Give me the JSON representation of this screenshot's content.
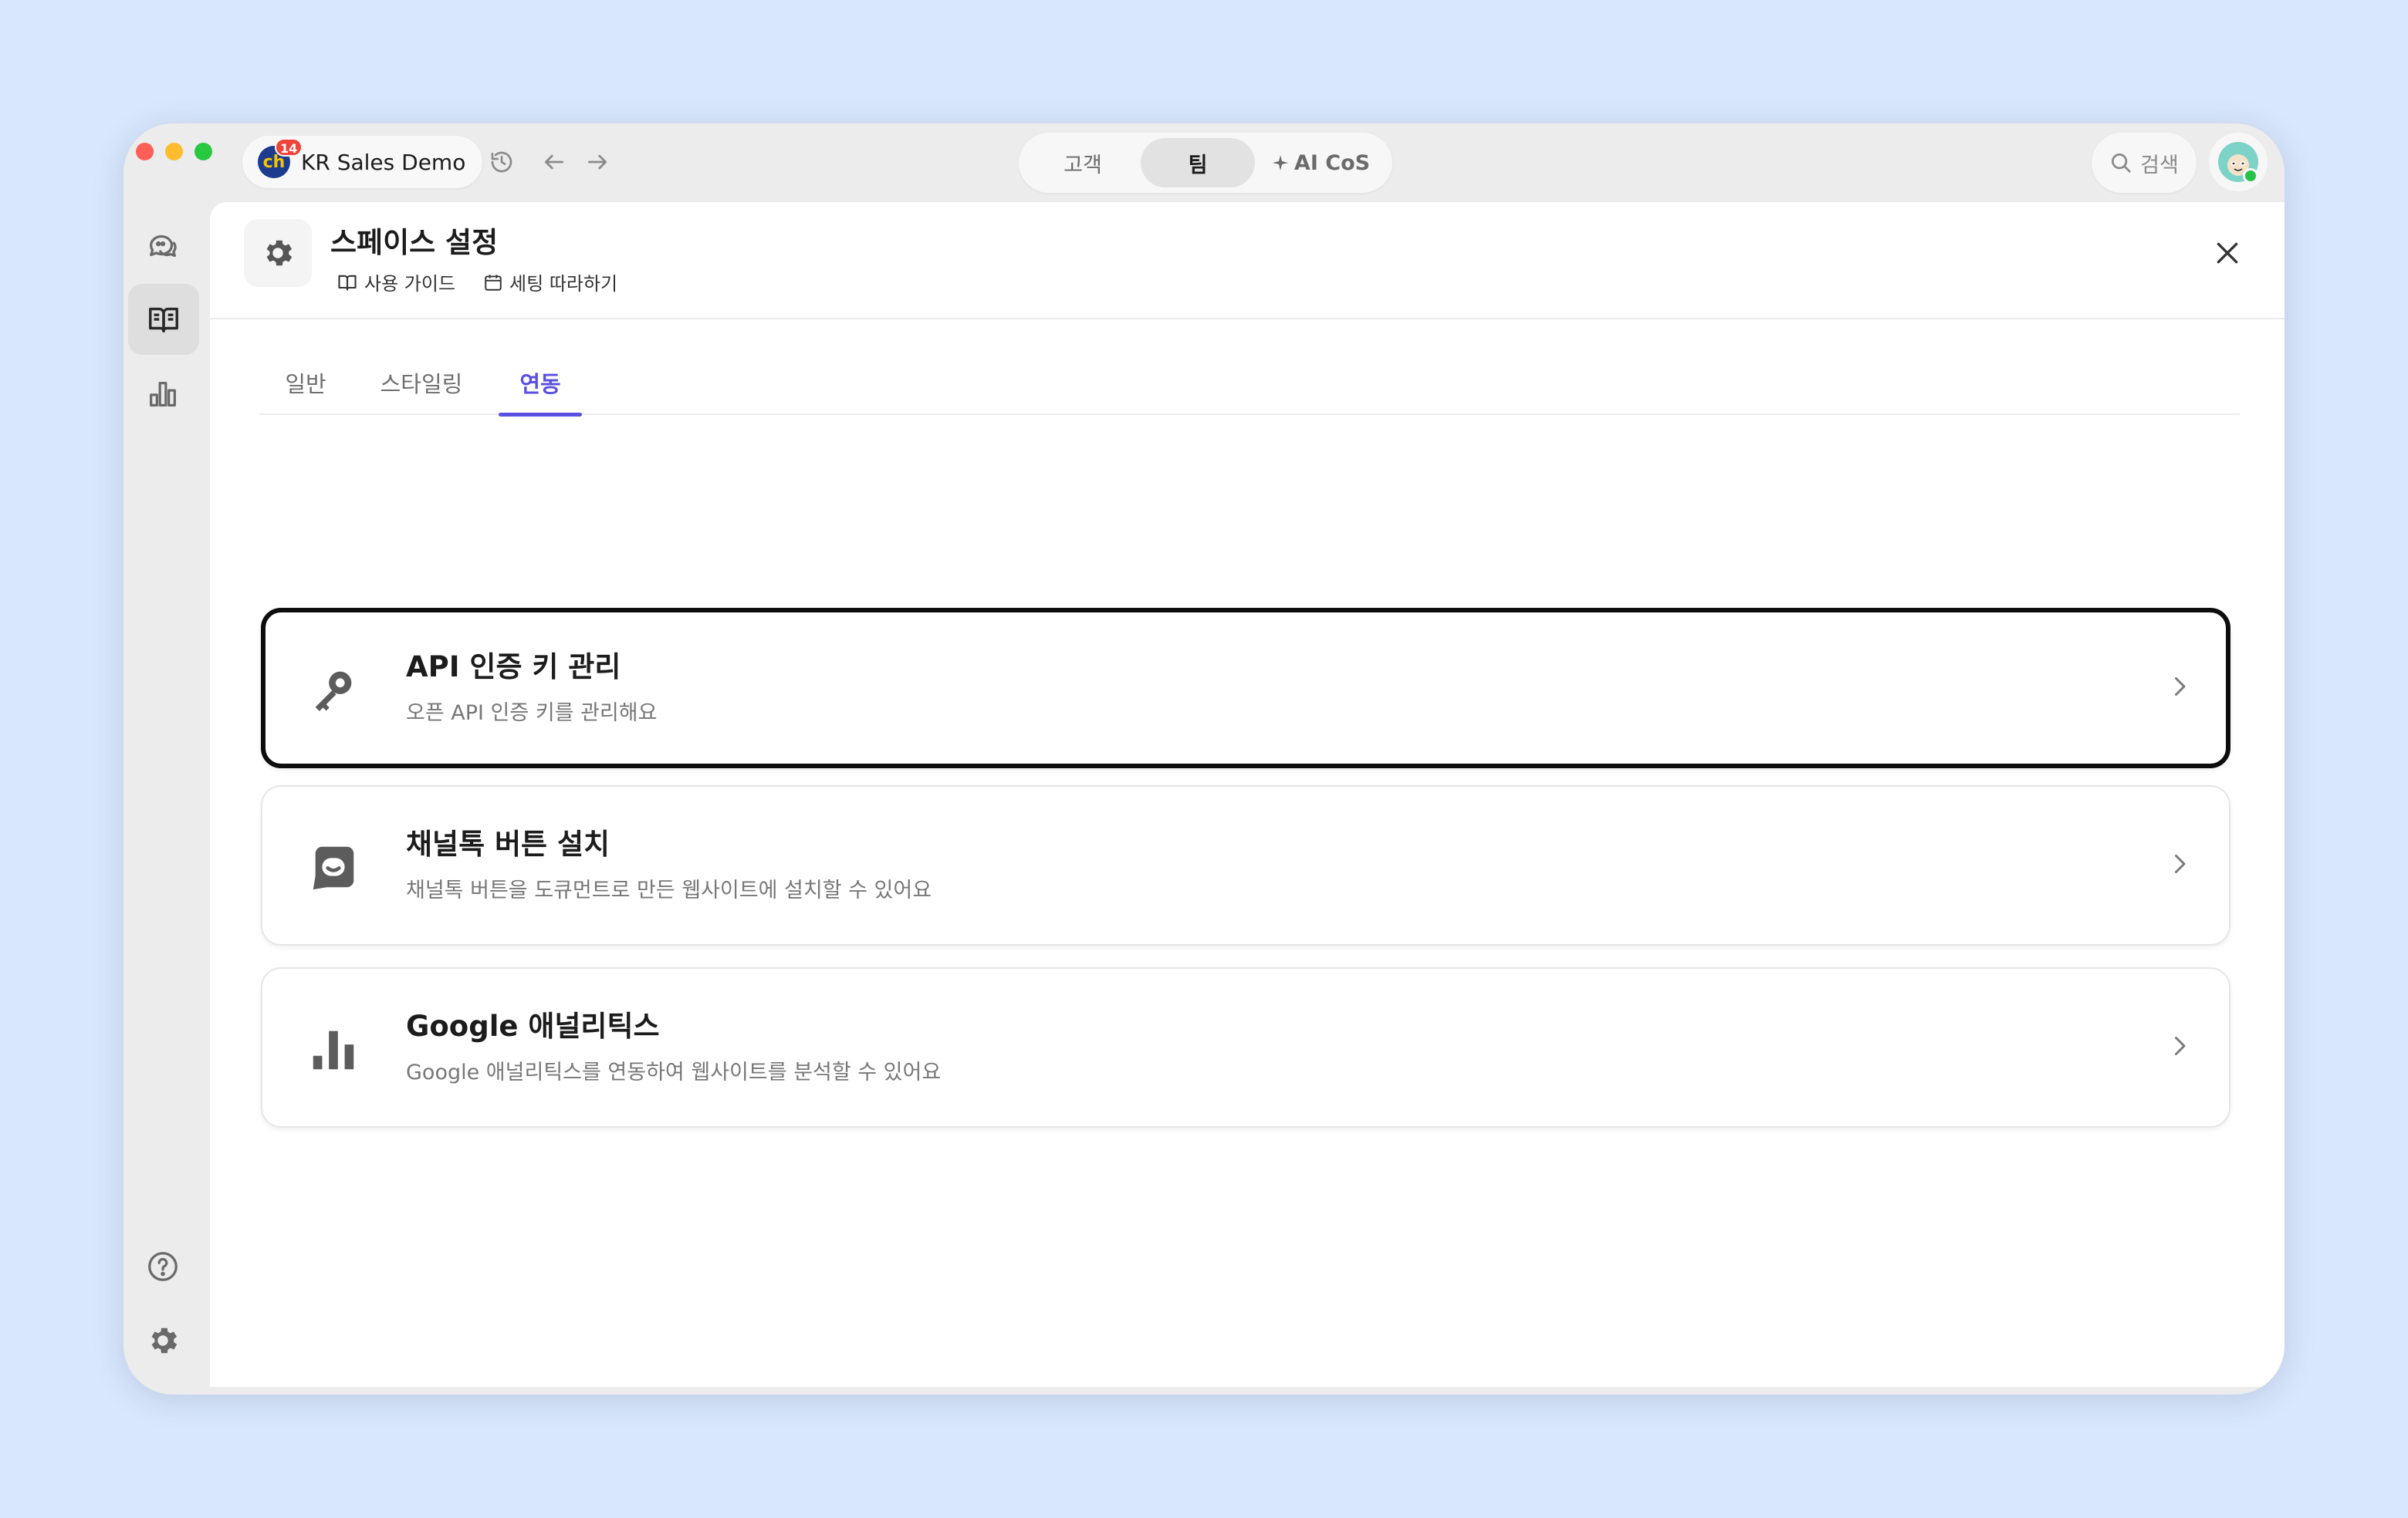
{
  "workspace": {
    "name": "KR Sales Demo",
    "badge": "14",
    "logo_text": "ch"
  },
  "segmented": {
    "customer": "고객",
    "team": "팀",
    "ai": "AI CoS",
    "ai_icon": "sparkle-icon"
  },
  "search": {
    "label": "검색"
  },
  "panel": {
    "title": "스페이스 설정",
    "guide": "사용 가이드",
    "setup": "세팅 따라하기"
  },
  "tabs": [
    {
      "label": "일반"
    },
    {
      "label": "스타일링"
    },
    {
      "label": "연동",
      "active": true
    }
  ],
  "cards": [
    {
      "title": "API 인증 키 관리",
      "desc": "오픈 API 인증 키를 관리해요",
      "icon": "key-icon"
    },
    {
      "title": "채널톡 버튼 설치",
      "desc": "채널톡 버튼을 도큐먼트로 만든 웹사이트에 설치할 수 있어요",
      "icon": "channeltalk-icon"
    },
    {
      "title": "Google 애널리틱스",
      "desc": "Google 애널리틱스를 연동하여 웹사이트를 분석할 수 있어요",
      "icon": "bar-chart-icon"
    }
  ],
  "colors": {
    "accent": "#5a51e0",
    "background": "#d8e7fc"
  }
}
